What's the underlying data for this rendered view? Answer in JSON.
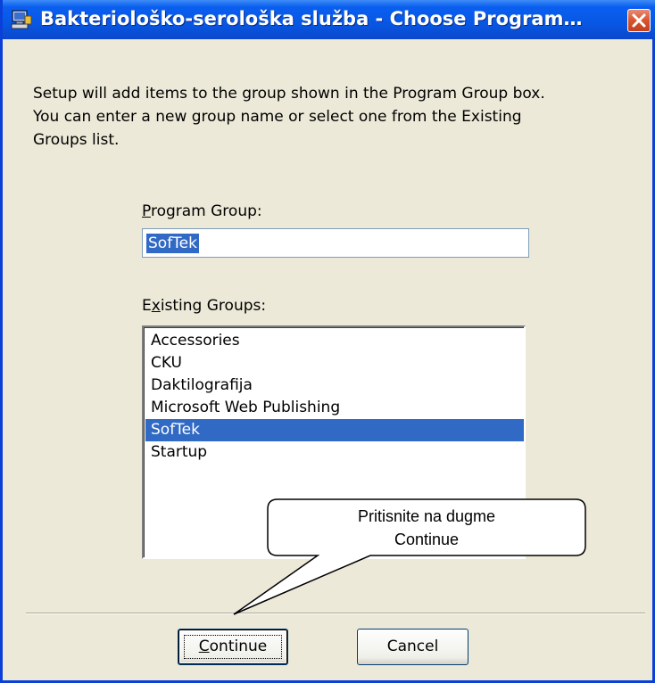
{
  "window": {
    "title": "Bakteriološko-serološka služba - Choose Program…",
    "close_icon": "close-icon",
    "app_icon": "setup-computer-icon"
  },
  "description": [
    "Setup will add items to the group shown in the Program Group box.",
    "You can enter a new group name or select one from the Existing",
    "Groups list."
  ],
  "program_group": {
    "label_mnemonic": "P",
    "label_rest": "rogram Group:",
    "value": "SofTek"
  },
  "existing_groups": {
    "label_pre": "E",
    "label_mnemonic": "x",
    "label_rest": "isting Groups:",
    "items": [
      {
        "label": "Accessories",
        "selected": false
      },
      {
        "label": "CKU",
        "selected": false
      },
      {
        "label": "Daktilografija",
        "selected": false
      },
      {
        "label": "Microsoft Web Publishing",
        "selected": false
      },
      {
        "label": "SofTek",
        "selected": true
      },
      {
        "label": "Startup",
        "selected": false
      }
    ]
  },
  "callout": {
    "line1": "Pritisnite na dugme",
    "line2": "Continue"
  },
  "buttons": {
    "continue_mnemonic": "C",
    "continue_rest": "ontinue",
    "cancel_label": "Cancel"
  },
  "colors": {
    "titlebar": "#0857e3",
    "dialog_bg": "#ece9d8",
    "selection": "#316ac5"
  }
}
